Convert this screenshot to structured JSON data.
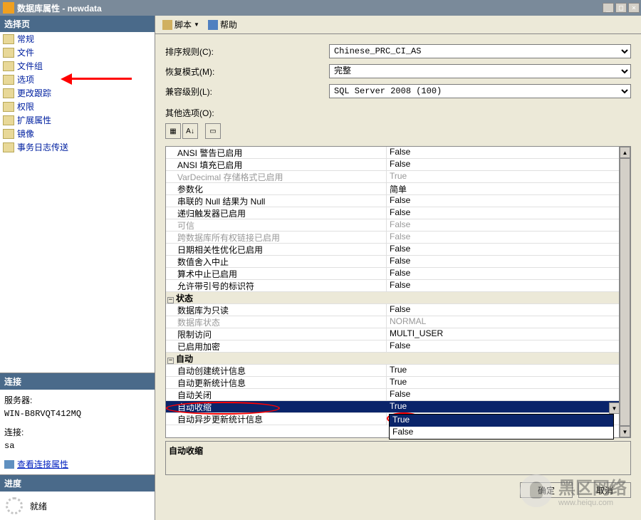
{
  "title": "数据库属性 - newdata",
  "sidebar": {
    "header": "选择页",
    "items": [
      {
        "label": "常规"
      },
      {
        "label": "文件"
      },
      {
        "label": "文件组"
      },
      {
        "label": "选项"
      },
      {
        "label": "更改跟踪"
      },
      {
        "label": "权限"
      },
      {
        "label": "扩展属性"
      },
      {
        "label": "镜像"
      },
      {
        "label": "事务日志传送"
      }
    ]
  },
  "connection": {
    "header": "连接",
    "server_lbl": "服务器:",
    "server": "WIN-B8RVQT412MQ",
    "conn_lbl": "连接:",
    "conn": "sa",
    "link": "查看连接属性"
  },
  "progress": {
    "header": "进度",
    "status": "就绪"
  },
  "toolbar": {
    "script": "脚本",
    "help": "帮助"
  },
  "form": {
    "collation_lbl": "排序规则(C):",
    "collation": "Chinese_PRC_CI_AS",
    "recovery_lbl": "恢复模式(M):",
    "recovery": "完整",
    "compat_lbl": "兼容级别(L):",
    "compat": "SQL Server 2008 (100)",
    "other_lbl": "其他选项(O):"
  },
  "grid": {
    "rows": [
      {
        "k": "ANSI 警告已启用",
        "v": "False"
      },
      {
        "k": "ANSI 填充已启用",
        "v": "False"
      },
      {
        "k": "VarDecimal 存储格式已启用",
        "v": "True",
        "dim": true
      },
      {
        "k": "参数化",
        "v": "简单"
      },
      {
        "k": "串联的 Null 结果为 Null",
        "v": "False"
      },
      {
        "k": "递归触发器已启用",
        "v": "False"
      },
      {
        "k": "可信",
        "v": "False",
        "dim": true
      },
      {
        "k": "跨数据库所有权链接已启用",
        "v": "False",
        "dim": true
      },
      {
        "k": "日期相关性优化已启用",
        "v": "False"
      },
      {
        "k": "数值舍入中止",
        "v": "False"
      },
      {
        "k": "算术中止已启用",
        "v": "False"
      },
      {
        "k": "允许带引号的标识符",
        "v": "False"
      },
      {
        "cat": "状态"
      },
      {
        "k": "数据库为只读",
        "v": "False"
      },
      {
        "k": "数据库状态",
        "v": "NORMAL",
        "dim": true
      },
      {
        "k": "限制访问",
        "v": "MULTI_USER"
      },
      {
        "k": "已启用加密",
        "v": "False"
      },
      {
        "cat": "自动"
      },
      {
        "k": "自动创建统计信息",
        "v": "True"
      },
      {
        "k": "自动更新统计信息",
        "v": "True"
      },
      {
        "k": "自动关闭",
        "v": "False"
      },
      {
        "k": "自动收缩",
        "v": "True",
        "sel": true
      },
      {
        "k": "自动异步更新统计信息",
        "v": ""
      }
    ],
    "dropdown": {
      "options": [
        "True",
        "False"
      ],
      "selected": "True"
    },
    "desc": "自动收缩"
  },
  "buttons": {
    "ok": "确定",
    "cancel": "取消"
  },
  "watermark": {
    "text": "黑区网络",
    "sub": "www.heiqu.com"
  }
}
